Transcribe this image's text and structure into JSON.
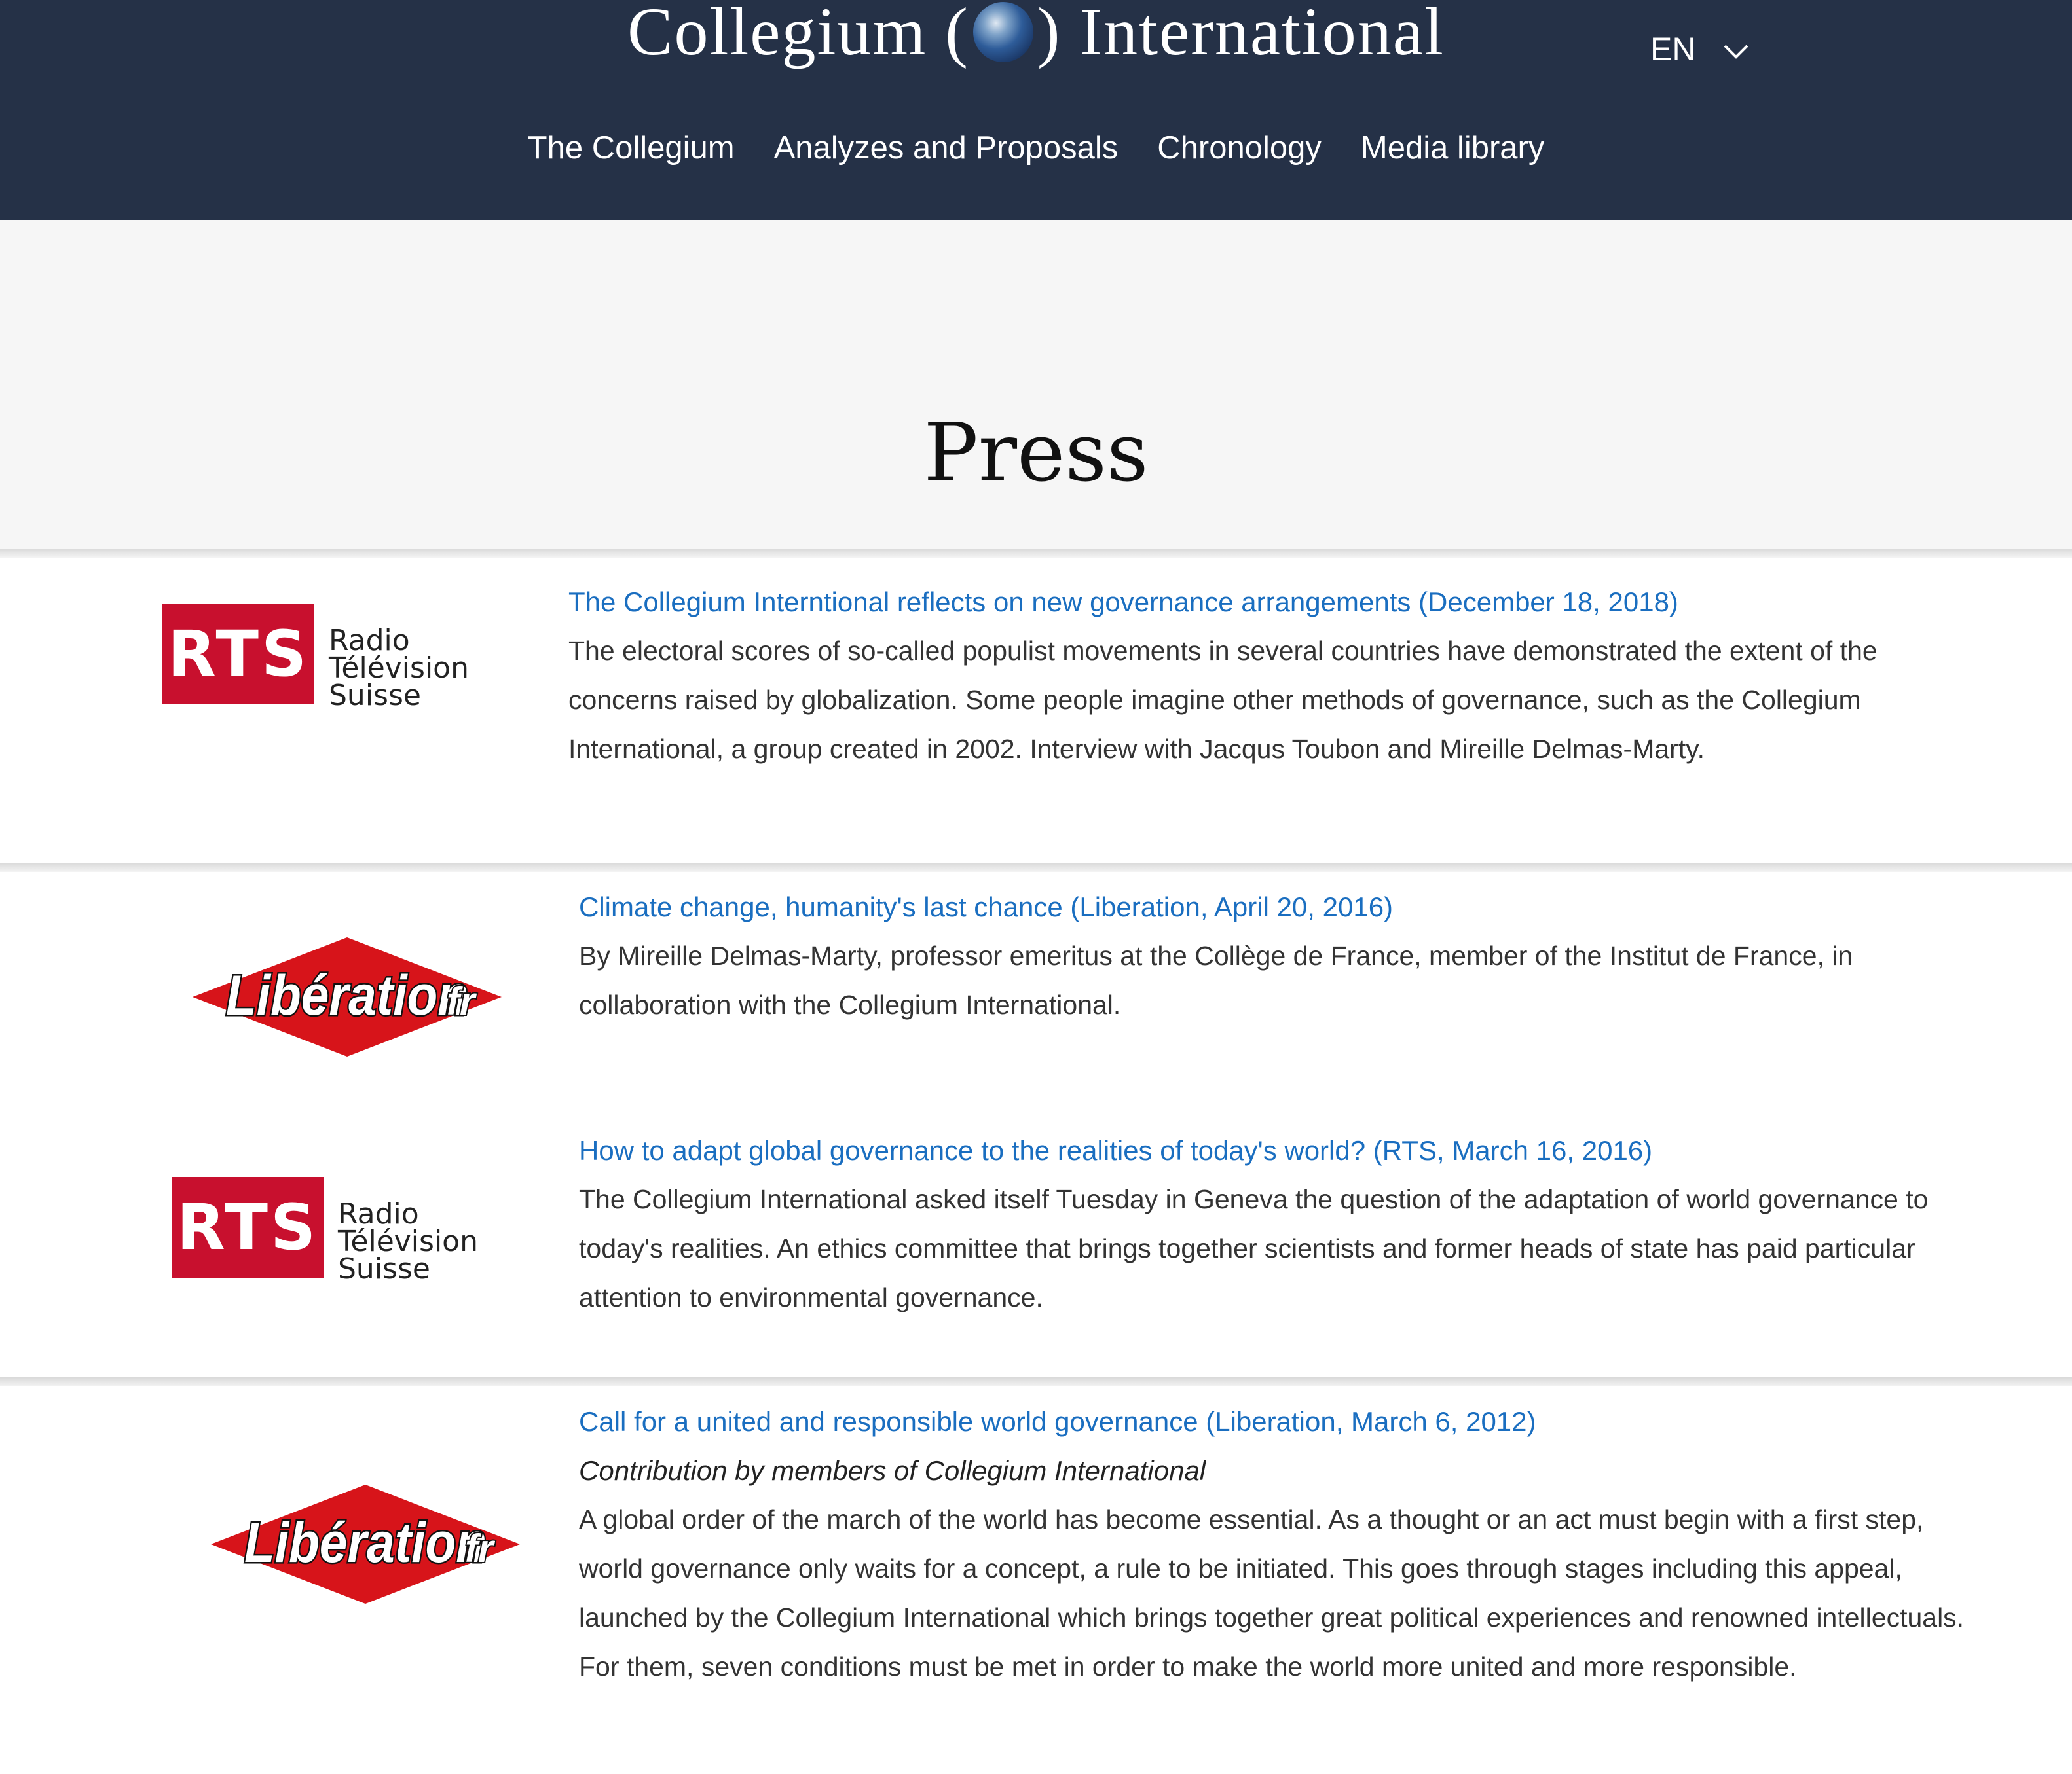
{
  "header": {
    "title_left": "Collegium",
    "title_right": "International",
    "globe_icon": "globe-icon",
    "language": "EN",
    "nav": [
      {
        "label": "The Collegium"
      },
      {
        "label": "Analyzes and Proposals"
      },
      {
        "label": "Chronology"
      },
      {
        "label": "Media library"
      }
    ]
  },
  "page": {
    "title": "Press"
  },
  "articles": [
    {
      "source_logo": "rts-logo",
      "logo_text": {
        "mark": "RTS",
        "line1": "Radio Télévision",
        "line2": "Suisse"
      },
      "title": "The Collegium Interntional reflects on new governance arrangements (December 18, 2018)",
      "body": "The electoral scores of so-called populist movements in several countries have demonstrated the extent of the concerns raised by globalization. Some people imagine other methods of governance, such as the Collegium International, a group created in 2002. Interview with Jacqus Toubon and Mireille Delmas-Marty."
    },
    {
      "source_logo": "liberation-logo",
      "logo_text": {
        "wordmark": "Libération",
        "suffix": "fr"
      },
      "title": "Climate change, humanity's last chance (Liberation, April 20, 2016)",
      "body": "By Mireille Delmas-Marty, professor emeritus at the Collège de France, member of the Institut de France, in collaboration with the Collegium International."
    },
    {
      "source_logo": "rts-logo",
      "logo_text": {
        "mark": "RTS",
        "line1": "Radio Télévision",
        "line2": "Suisse"
      },
      "title": "How to adapt global governance to the realities of today's world? (RTS, March 16, 2016)",
      "body": "The Collegium International asked itself Tuesday in Geneva the question of the adaptation of world governance to today's realities. An ethics committee that brings together scientists and former heads of state has paid particular attention to environmental governance."
    },
    {
      "source_logo": "liberation-logo",
      "logo_text": {
        "wordmark": "Libération",
        "suffix": "fr"
      },
      "title": "Call for a united and responsible world governance (Liberation, March 6, 2012)",
      "subtitle": "Contribution by members of Collegium International",
      "body": "A global order of the march of the world has become essential. As a thought or an act must begin with a first step, world governance only waits for a concept, a rule to be initiated. This goes through stages including this appeal, launched by the Collegium International which brings together great political experiences and renowned intellectuals. For them, seven conditions must be met in order to make the world more united and more responsible."
    }
  ],
  "colors": {
    "header_bg": "#253147",
    "link": "#1a6ec0",
    "rts_red": "#c8102e",
    "liberation_red": "#d7141a"
  }
}
